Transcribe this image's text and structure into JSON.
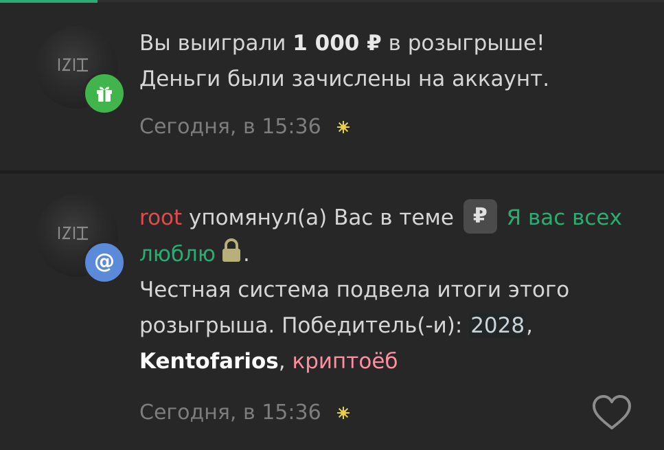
{
  "notifications": [
    {
      "type": "gift",
      "text": {
        "part1": "Вы выиграли ",
        "amount": "1 000 ₽",
        "part2": " в розыгрыше!",
        "line2": "Деньги были зачислены на аккаунт."
      },
      "time": "Сегодня, в 15:36",
      "badge_icon": "gift-icon",
      "badge_color": "#3fb54c"
    },
    {
      "type": "mention",
      "user": "root",
      "user_color": "#e04b4b",
      "action": " упомянул(а) Вас в теме ",
      "prefix": "₽",
      "thread_title": "Я вас всех люблю",
      "thread_color": "#2bad72",
      "after_lock": ".",
      "body": "Честная система подвела итоги этого розыгрыша. Победитель(-и): ",
      "winners": [
        "2028",
        "Kentofarios",
        "криптоёб"
      ],
      "separator": ", ",
      "time": "Сегодня, в 15:36",
      "badge_symbol": "@",
      "badge_color": "#5b8bd8",
      "lock_icon": "lock-icon",
      "like_icon": "heart-icon"
    }
  ],
  "colors": {
    "background": "#272727",
    "accent": "#2bad72",
    "winner_highlight": "#ff8fa0"
  }
}
